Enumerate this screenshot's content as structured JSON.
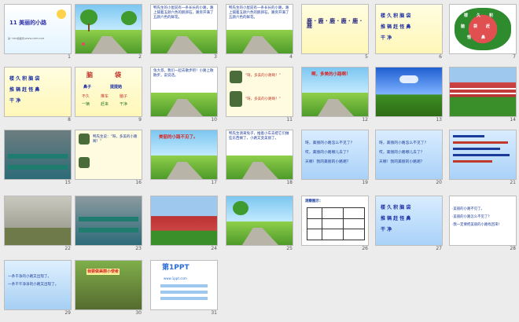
{
  "slides": [
    {
      "n": "1",
      "title": "11 美丽的小路",
      "sub": "第一PPT模板网-WWW.1PPT.COM"
    },
    {
      "n": "2"
    },
    {
      "n": "3",
      "text": "鸭先生的小屋前有一条长长的小路，路上铺着五颜六色的鹅卵石，路旁开满了五颜六色的鲜花。"
    },
    {
      "n": "4",
      "text": "鸭先生的小屋前有一条长长的小路，路上铺着五颜六色的鹅卵石，路旁开满了五颜六色的鲜花。"
    },
    {
      "n": "5",
      "chars": "鹿 · 鹿 · 鹿 · 鹿 · 鹿 · 鹿"
    },
    {
      "n": "6",
      "rows": [
        "楼 久 积 脑 袋",
        "推 辆 赶 怪 鼻",
        "干 净"
      ]
    },
    {
      "n": "7",
      "chars": [
        "楼",
        "久",
        "积",
        "脑",
        "袋",
        "赶",
        "怪",
        "鼻"
      ]
    },
    {
      "n": "8",
      "rows": [
        "楼 久 积 脑 袋",
        "推 辆 赶 怪 鼻",
        "干 净"
      ]
    },
    {
      "n": "9",
      "words": [
        "脑",
        "袋",
        "鼻子",
        "提提她",
        "不久",
        "推车",
        "脑子",
        "一辆",
        "赶来",
        "干净"
      ]
    },
    {
      "n": "10",
      "text": "兔大叔，我们一起去散步吧！小路上散散步，说说话。"
    },
    {
      "n": "11",
      "q1": "\"呀，多美的小路啊！\"",
      "q2": "\"呀，多美的小路啊！\""
    },
    {
      "n": "12",
      "title": "啊，多美的小路啊！"
    },
    {
      "n": "13"
    },
    {
      "n": "14"
    },
    {
      "n": "15"
    },
    {
      "n": "16",
      "text": "鸭先生说：“呀，多美的小路啊！”"
    },
    {
      "n": "17",
      "title": "美丽的小路不见了。"
    },
    {
      "n": "18",
      "text": "鸭先生请来兔子，推着小车去把它们做些东西摘了，小路又变美丽了。"
    },
    {
      "n": "19",
      "lines": [
        "呀，美丽的小路怎么不见了？",
        "哎，美丽的小路哪儿去了？",
        "天哪！我的美丽的小路呢？"
      ]
    },
    {
      "n": "20",
      "lines": [
        "呀，美丽的小路怎么不见了？",
        "哎，美丽的小路哪儿去了？",
        "天哪！我的美丽的小路呢？"
      ]
    },
    {
      "n": "21"
    },
    {
      "n": "22"
    },
    {
      "n": "23"
    },
    {
      "n": "24"
    },
    {
      "n": "25"
    },
    {
      "n": "26",
      "title": "观察图示："
    },
    {
      "n": "27",
      "rows": [
        "楼 久 积 脑 袋",
        "推 辆 赶 怪 鼻",
        "干 净"
      ]
    },
    {
      "n": "28",
      "lines": [
        "·美丽的小路不见了。",
        "·美丽的小路怎么不见了？",
        "·我一定要把美丽的小路找回来！"
      ]
    },
    {
      "n": "29",
      "lines": [
        "一条干净的小路又出现了。",
        "一条干干净净的小路又出现了。"
      ]
    },
    {
      "n": "30",
      "title": "我要做美丽小使者"
    },
    {
      "n": "31",
      "logo": "第1PPT",
      "sub": "www.1ppt.com"
    }
  ]
}
